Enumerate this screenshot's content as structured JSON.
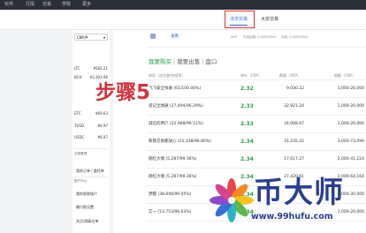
{
  "topnav": {
    "items": [
      "买币",
      "行情",
      "交易",
      "学院",
      "更多"
    ]
  },
  "subnav": {
    "tabs": [
      "法币交易",
      "大宗交易"
    ]
  },
  "sidebar": {
    "currency": "CNY/¥",
    "coins": [
      {
        "symbol": "LTC",
        "price": "¥582.21"
      },
      {
        "symbol": "BCH",
        "price": "¥3,303.96"
      },
      {
        "symbol": "ETC",
        "price": "¥69.63"
      },
      {
        "symbol": "TUSD",
        "price": "¥6.97"
      },
      {
        "symbol": "USDC",
        "price": "¥6.97"
      }
    ],
    "section_orders": {
      "title": "交易管理",
      "items": [
        "我的订单 / 委托单"
      ]
    },
    "section_account": {
      "title": "账户中心",
      "items": [
        "我的收款账户",
        "硬付款设置",
        "关注/屏蔽名单"
      ]
    }
  },
  "annotation": "步骤5",
  "main": {
    "user": {
      "name": "查看",
      "link": "查看",
      "balances": [
        "XRP",
        "可用余额: 0.00000000",
        "冻结: 0.00000000"
      ]
    },
    "tabs": [
      "我要购买",
      "我要出售",
      "盘口"
    ],
    "columns": [
      "商家（成交量/完成率）",
      "单价（CNY）",
      "数量（XRP）",
      "限额（CNY）"
    ],
    "rows": [
      {
        "merchant": "飞飞安全快收 (61/100.00%)",
        "price": "2.32",
        "qty": "9,030.22",
        "limit": "1,000-20,000"
      },
      {
        "merchant": "诺记全球通 (27,494/96.29%)",
        "price": "2.33",
        "qty": "32,921.24",
        "limit": "1,000-20,000"
      },
      {
        "merchant": "诚信的用户 (22,968/99.51%)",
        "price": "2.33",
        "qty": "34,068.67",
        "limit": "1,000-20,000"
      },
      {
        "merchant": "和我交易都放心 (25,338/96.80%)",
        "price": "2.34",
        "qty": "31,235.42",
        "limit": "3,000-73,090"
      },
      {
        "merchant": "刚红大储 (5,287/99.36%)",
        "price": "2.34",
        "qty": "17,617.27",
        "limit": "2,000-41,224"
      },
      {
        "merchant": "刚红大储 (5,287/99.36%)",
        "price": "2.34",
        "qty": "27,420.61",
        "limit": "2,000-64,164"
      },
      {
        "merchant": "梦醒 (38,646/99.05%)",
        "price": "2.34",
        "qty": "",
        "limit": "1,000-30,000"
      },
      {
        "merchant": "艾一 (13,753/99.63%)",
        "price": "2.34",
        "qty": "",
        "limit": "1,000-20,000"
      }
    ]
  },
  "watermark": {
    "text": "币大师",
    "url": "www.99hufu.com"
  }
}
